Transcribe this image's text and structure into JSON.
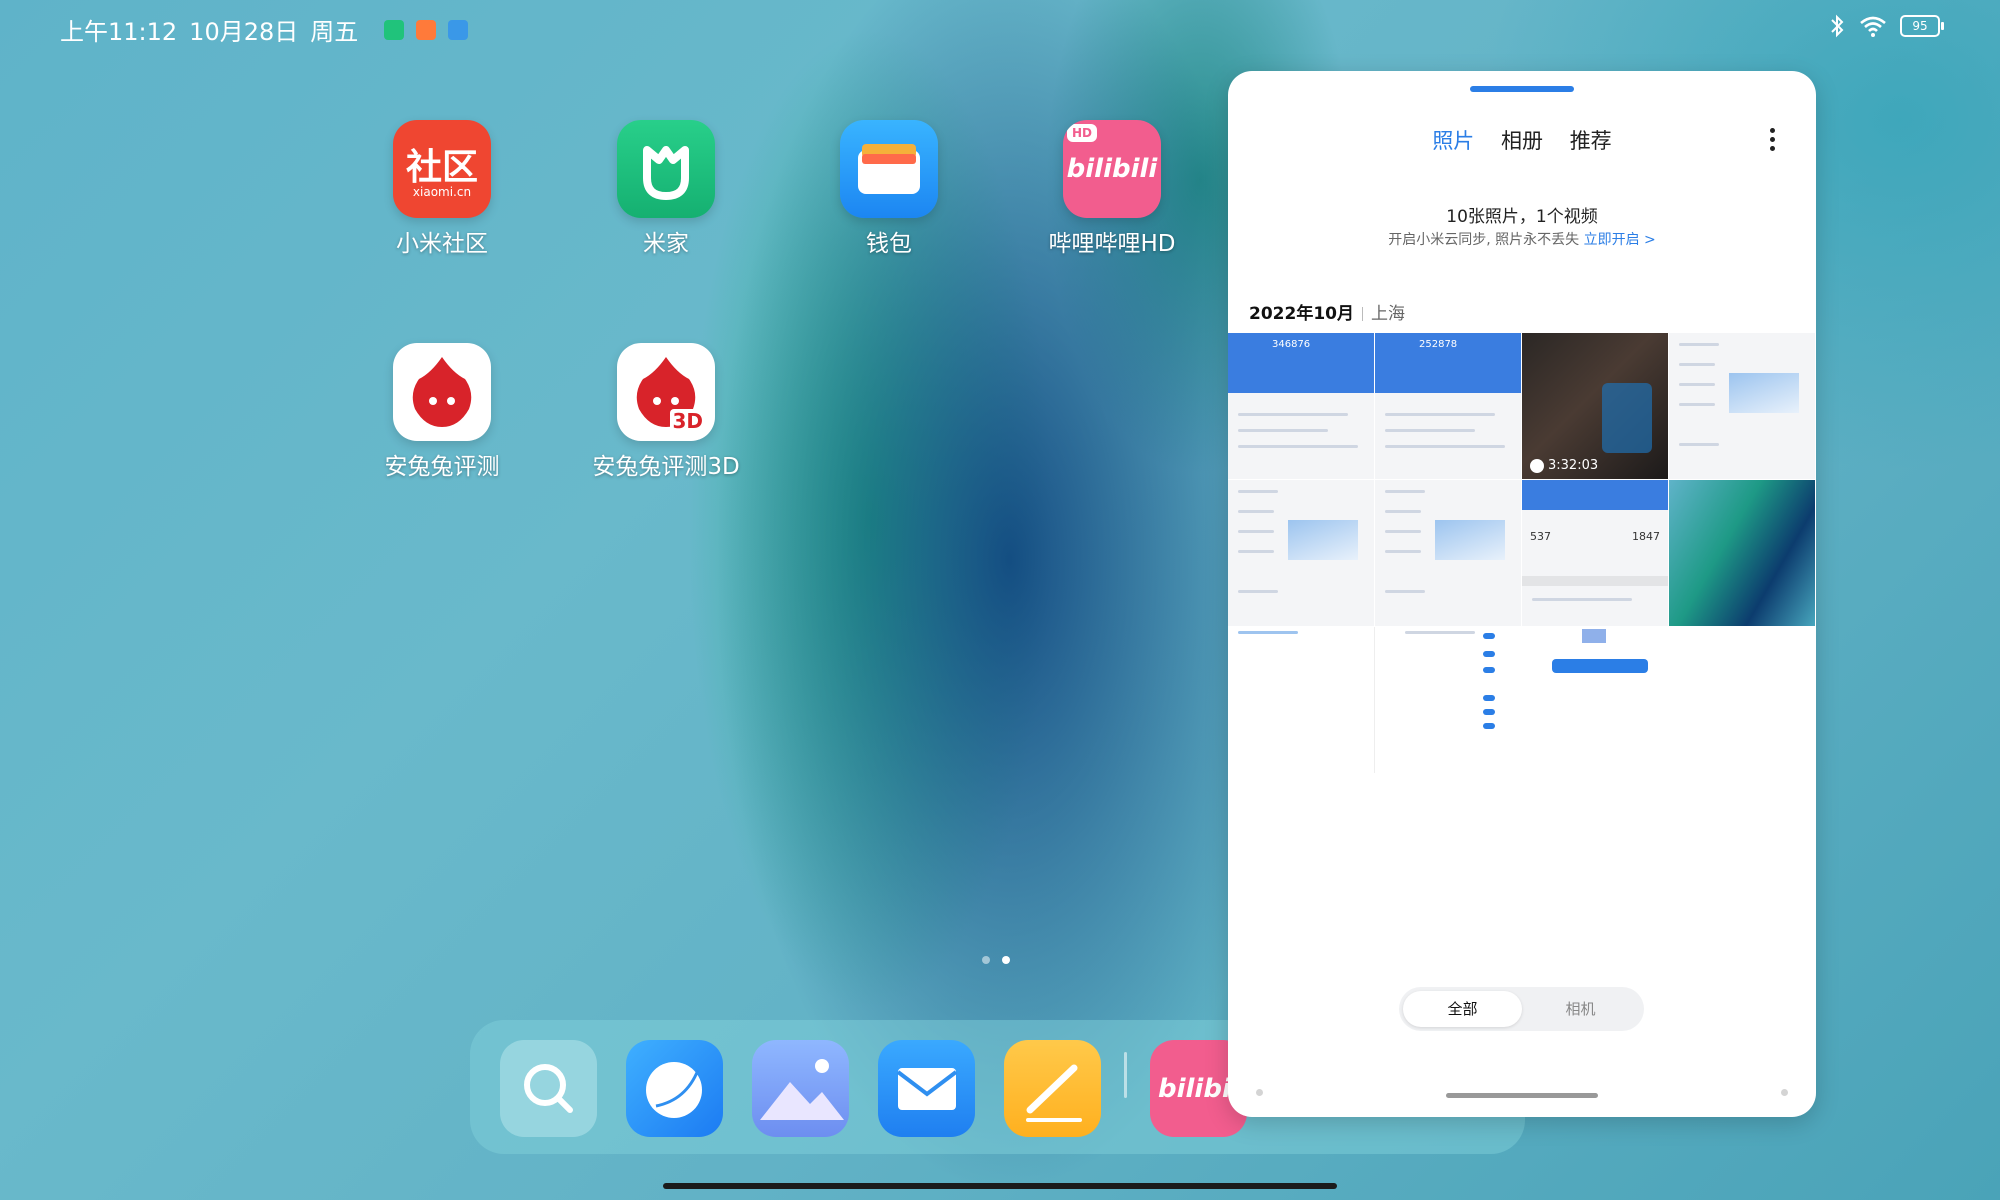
{
  "status_bar": {
    "time": "上午11:12",
    "date": "10月28日",
    "weekday": "周五",
    "battery": "95"
  },
  "home_apps": [
    {
      "label": "小米社区",
      "badge_text": "社区",
      "badge_sub": "xiaomi.cn",
      "color": "#ef4631"
    },
    {
      "label": "米家",
      "color": "#1fbf7f"
    },
    {
      "label": "钱包",
      "color": "#2ea0ff"
    },
    {
      "label": "哔哩哔哩HD",
      "badge_text": "bilibili",
      "badge_corner": "HD",
      "color": "#f25d8e"
    },
    {
      "label": "安兔兔评测",
      "color": "#ffffff"
    },
    {
      "label": "安兔兔评测3D",
      "badge_corner": "3D",
      "color": "#ffffff"
    }
  ],
  "dock": {
    "apps": [
      "search-app",
      "browser-app",
      "gallery-app",
      "email-app",
      "notes-app",
      "bilibili-hd-app"
    ]
  },
  "gallery": {
    "tabs": [
      "照片",
      "相册",
      "推荐"
    ],
    "active_tab": "照片",
    "summary": "10张照片，1个视频",
    "sync_text": "开启小米云同步, 照片永不丢失",
    "sync_link": "立即开启 >",
    "section_date": "2022年10月",
    "section_location": "上海",
    "thumbs": [
      {
        "type": "screenshot",
        "score": "346876"
      },
      {
        "type": "screenshot",
        "score": "252878"
      },
      {
        "type": "video",
        "duration": "3:32:03"
      },
      {
        "type": "settings"
      },
      {
        "type": "settings"
      },
      {
        "type": "settings"
      },
      {
        "type": "stats",
        "left_value": "537",
        "right_value": "1847"
      },
      {
        "type": "wallpaper"
      },
      {
        "type": "blank"
      },
      {
        "type": "toggles"
      },
      {
        "type": "dialog"
      }
    ],
    "filter": [
      "全部",
      "相机"
    ],
    "active_filter": "全部"
  },
  "page_indicator": {
    "pages": 2,
    "current": 2
  }
}
